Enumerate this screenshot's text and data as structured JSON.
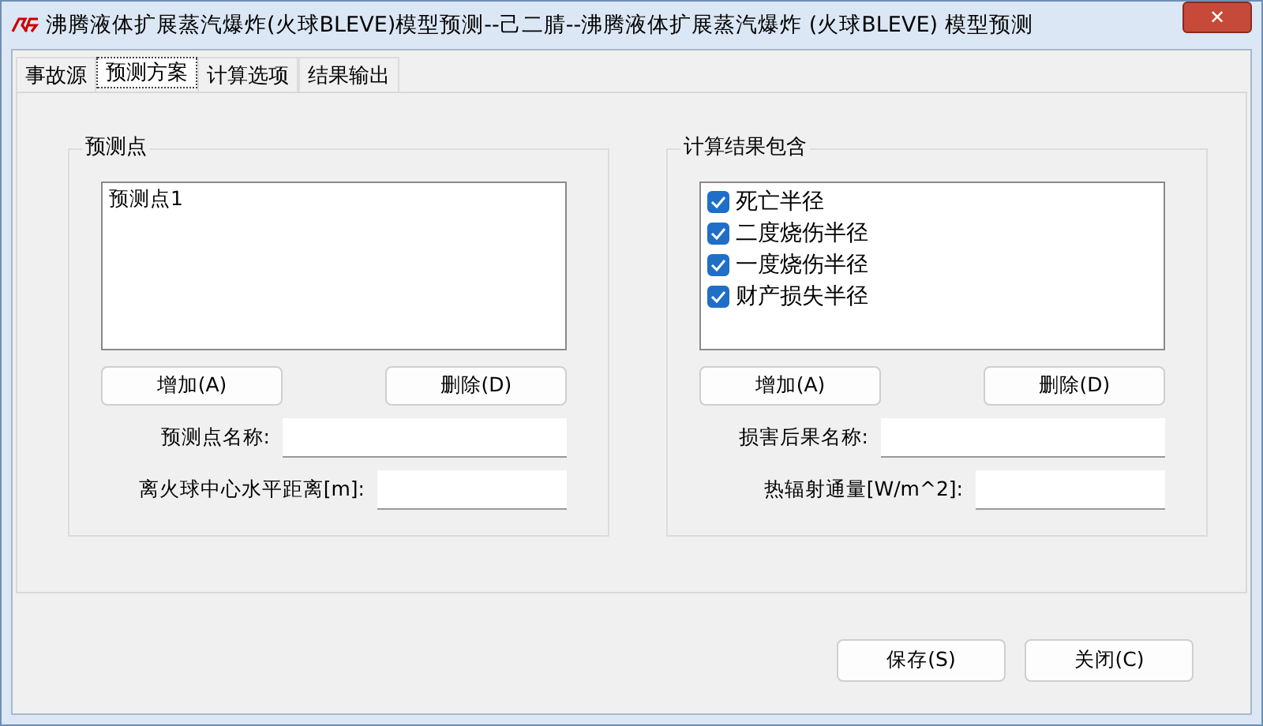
{
  "window": {
    "title": "沸腾液体扩展蒸汽爆炸(火球BLEVE)模型预测--己二腈--沸腾液体扩展蒸汽爆炸 (火球BLEVE) 模型预测",
    "close": "✕"
  },
  "tabs": [
    {
      "label": "事故源",
      "selected": false
    },
    {
      "label": "预测方案",
      "selected": true
    },
    {
      "label": "计算选项",
      "selected": false
    },
    {
      "label": "结果输出",
      "selected": false
    }
  ],
  "groups": [
    {
      "title": "预测点",
      "kind": "list",
      "items": [
        {
          "label": "预测点1"
        }
      ],
      "buttons": [
        "增加(A)",
        "删除(D)"
      ],
      "fields": [
        {
          "label": "预测点名称:"
        },
        {
          "label": "离火球中心水平距离[m]:"
        }
      ]
    },
    {
      "title": "计算结果包含",
      "kind": "checklist",
      "items": [
        {
          "label": "死亡半径",
          "checked": true
        },
        {
          "label": "二度烧伤半径",
          "checked": true
        },
        {
          "label": "一度烧伤半径",
          "checked": true
        },
        {
          "label": "财产损失半径",
          "checked": true
        }
      ],
      "buttons": [
        "增加(A)",
        "删除(D)"
      ],
      "fields": [
        {
          "label": "损害后果名称:"
        },
        {
          "label": "热辐射通量[W/m^2]:"
        }
      ]
    }
  ],
  "buttons": [
    "保存(S)",
    "关闭(C)"
  ]
}
